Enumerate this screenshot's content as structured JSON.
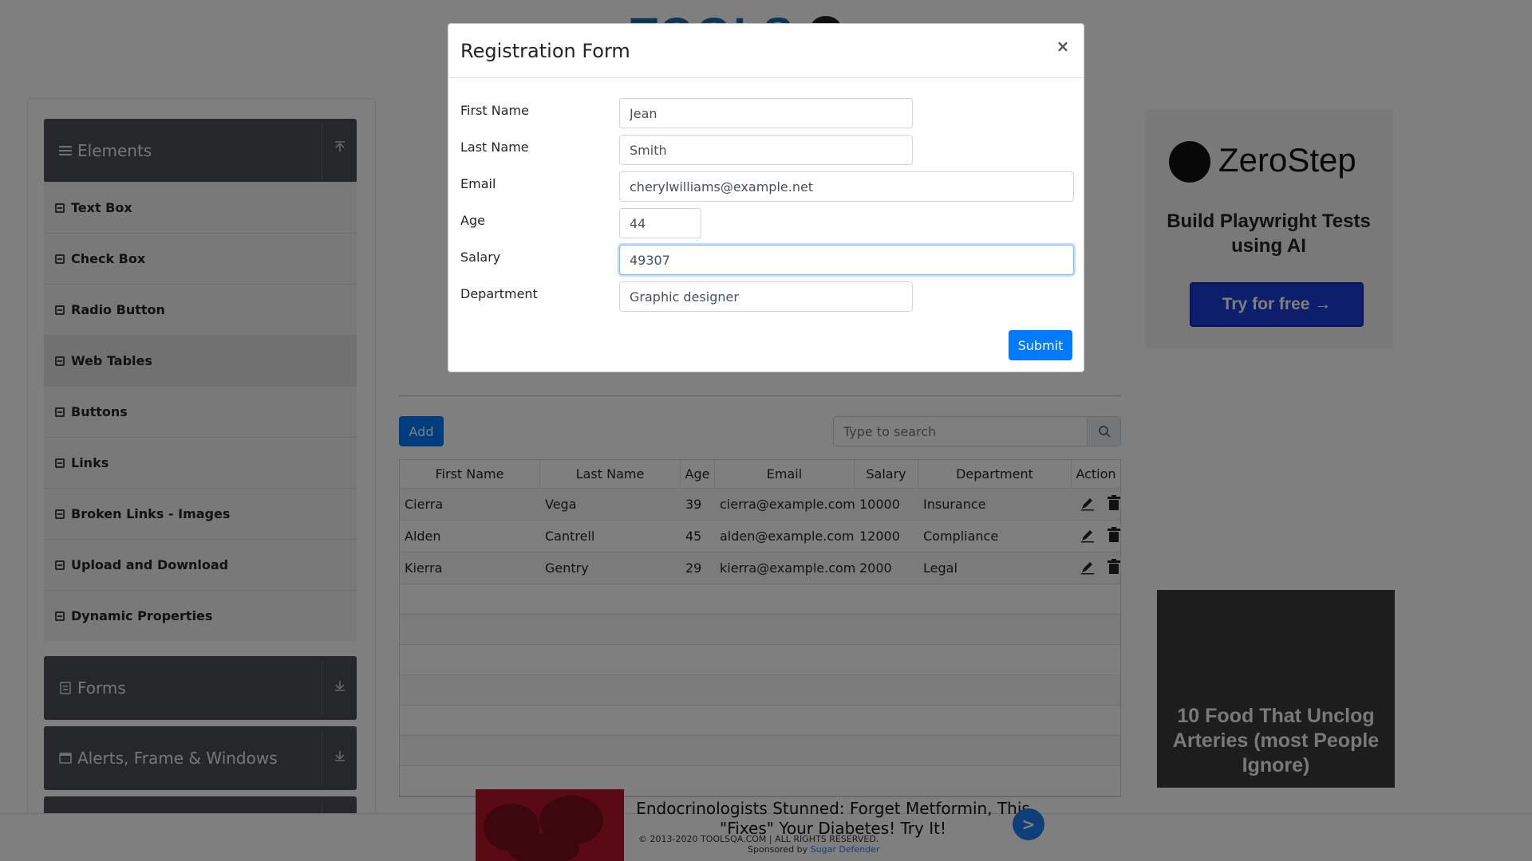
{
  "modal": {
    "title": "Registration Form",
    "close": "×",
    "fields": [
      {
        "label": "First Name",
        "value": "Jean"
      },
      {
        "label": "Last Name",
        "value": "Smith"
      },
      {
        "label": "Email",
        "value": "cherylwilliams@example.net"
      },
      {
        "label": "Age",
        "value": "44"
      },
      {
        "label": "Salary",
        "value": "49307"
      },
      {
        "label": "Department",
        "value": "Graphic designer"
      }
    ],
    "submit": "Submit"
  },
  "sidebar": {
    "groups": [
      "Elements",
      "Forms",
      "Alerts, Frame & Windows"
    ],
    "items": [
      "Text Box",
      "Check Box",
      "Radio Button",
      "Web Tables",
      "Buttons",
      "Links",
      "Broken Links - Images",
      "Upload and Download",
      "Dynamic Properties"
    ]
  },
  "toolbar": {
    "add": "Add",
    "search_placeholder": "Type to search"
  },
  "table": {
    "headers": [
      "First Name",
      "Last Name",
      "Age",
      "Email",
      "Salary",
      "Department",
      "Action"
    ],
    "rows": [
      [
        "Cierra",
        "Vega",
        "39",
        "cierra@example.com",
        "10000",
        "Insurance"
      ],
      [
        "Alden",
        "Cantrell",
        "45",
        "alden@example.com",
        "12000",
        "Compliance"
      ],
      [
        "Kierra",
        "Gentry",
        "29",
        "kierra@example.com",
        "2000",
        "Legal"
      ]
    ]
  },
  "ads": {
    "right_brand": "ZeroStep",
    "right_tagline": "Build Playwright Tests using AI",
    "right_button": "Try for free →",
    "right2_text": "10 Food That Unclog Arteries (most People Ignore)",
    "bottom_text": "Endocrinologists Stunned: Forget Metformin, This \"Fixes\" Your Diabetes! Try It!",
    "bottom_arrow": ">"
  },
  "footer": {
    "copyright": "© 2013-2020 TOOLSQA.COM | ALL RIGHTS RESERVED.",
    "sponsored": "Sponsored by",
    "sponsor_name": "Sugar Defender"
  },
  "colors": {
    "primary": "#007bff",
    "sidebar_header": "#4a4f57",
    "overlay": "rgba(0,0,0,0.5)"
  }
}
